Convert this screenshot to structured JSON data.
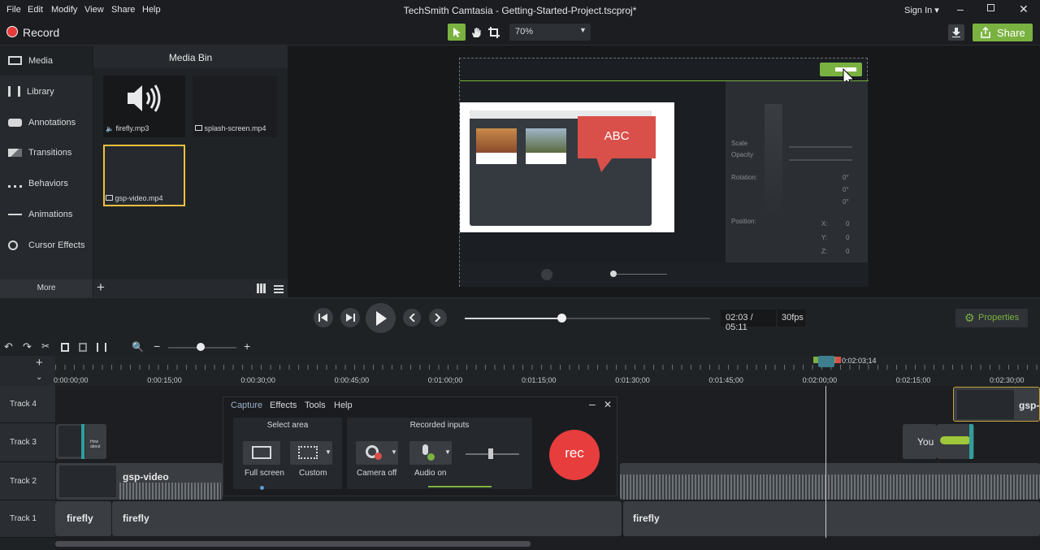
{
  "menu": {
    "file": "File",
    "edit": "Edit",
    "modify": "Modify",
    "view": "View",
    "share": "Share",
    "help": "Help",
    "title": "TechSmith Camtasia - Getting-Started-Project.tscproj*",
    "signin": "Sign In"
  },
  "toolbar": {
    "record": "Record",
    "zoom": "70%",
    "share": "Share"
  },
  "sidebar": {
    "items": [
      "Media",
      "Library",
      "Annotations",
      "Transitions",
      "Behaviors",
      "Animations",
      "Cursor Effects"
    ],
    "more": "More"
  },
  "bin": {
    "title": "Media Bin",
    "items": [
      "firefly.mp3",
      "splash-screen.mp4",
      "gsp-video.mp4"
    ]
  },
  "preview": {
    "bubble": "ABC",
    "scale": "Scale",
    "opacity": "Opacity",
    "rotation": "Rotation:",
    "position": "Position:",
    "deg": "0°",
    "x": "X:",
    "y": "Y:",
    "z": "Z:",
    "zero": "0"
  },
  "playback": {
    "time": "02:03 / 05:11",
    "fps": "30fps",
    "properties": "Properties"
  },
  "ruler": {
    "playhead": "0:02:03;14",
    "ticks": [
      "0:00:00;00",
      "0:00:15;00",
      "0:00:30;00",
      "0:00:45;00",
      "0:01:00;00",
      "0:01:15;00",
      "0:01:30;00",
      "0:01:45;00",
      "0:02:00;00",
      "0:02:15;00",
      "0:02:30;00"
    ]
  },
  "tracks": [
    "Track 4",
    "Track 3",
    "Track 2",
    "Track 1"
  ],
  "clips": {
    "gsp": "gsp-video",
    "gsp_trunc": "gsp-",
    "firefly": "firefly",
    "you": "You",
    "how": "How about"
  },
  "capture": {
    "tabs": [
      "Capture",
      "Effects",
      "Tools",
      "Help"
    ],
    "select_area": "Select area",
    "recorded_inputs": "Recorded inputs",
    "full_screen": "Full screen",
    "custom": "Custom",
    "camera": "Camera off",
    "audio": "Audio on",
    "rec": "rec"
  }
}
